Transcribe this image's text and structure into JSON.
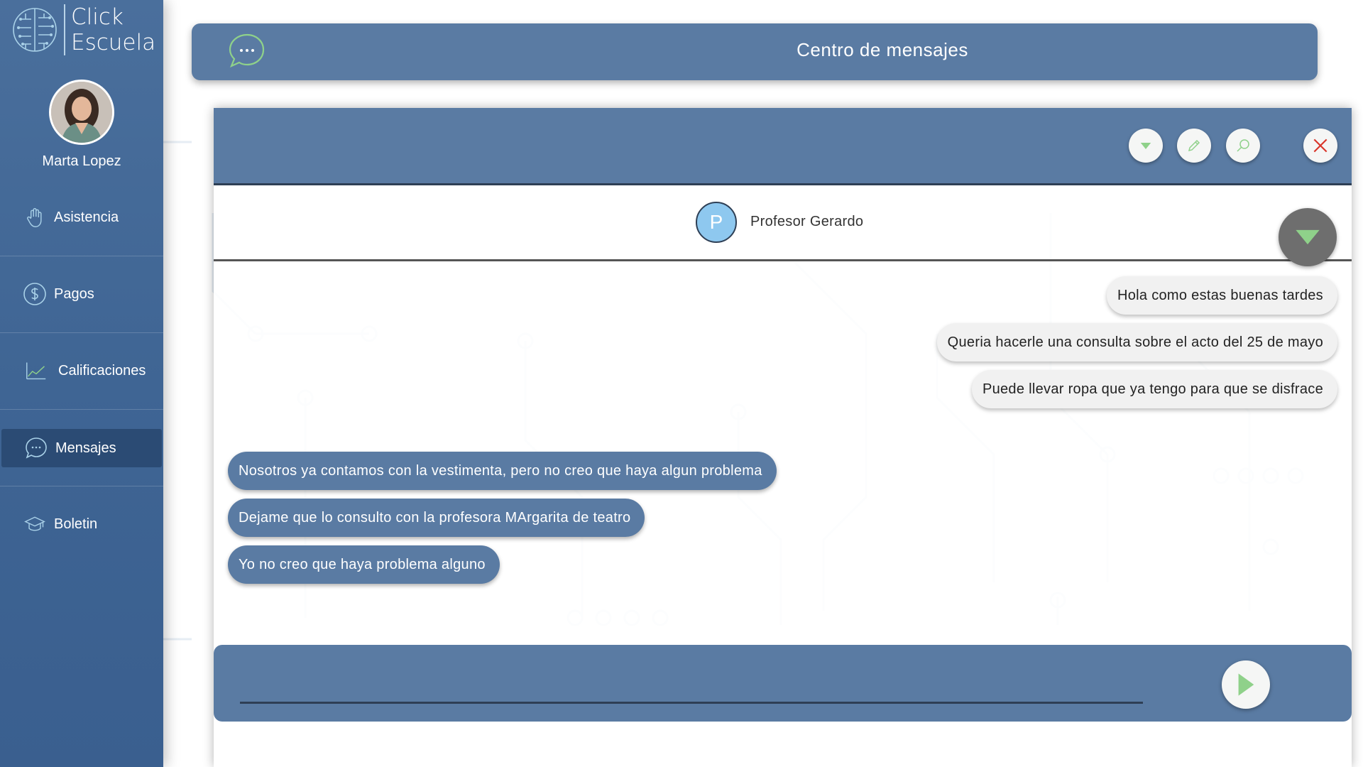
{
  "app": {
    "logo_line1": "Click",
    "logo_line2": "Escuela"
  },
  "user": {
    "name": "Marta Lopez"
  },
  "sidebar": {
    "items": [
      {
        "label": "Asistencia",
        "icon": "hand-icon"
      },
      {
        "label": "Pagos",
        "icon": "dollar-icon"
      },
      {
        "label": "Calificaciones",
        "icon": "chart-icon"
      },
      {
        "label": "Mensajes",
        "icon": "chat-icon",
        "active": true
      },
      {
        "label": "Boletin",
        "icon": "graduation-cap-icon"
      }
    ]
  },
  "header": {
    "title": "Centro de mensajes",
    "icon": "chat-icon"
  },
  "toolbar": {
    "buttons": [
      "dropdown-icon",
      "pencil-icon",
      "search-icon",
      "close-icon"
    ]
  },
  "contact": {
    "initial": "P",
    "name": "Profesor Gerardo"
  },
  "messages": {
    "sent": [
      "Hola como estas buenas tardes",
      "Queria hacerle una consulta sobre el acto del 25 de mayo",
      "Puede llevar ropa que ya tengo para que se disfrace"
    ],
    "received": [
      "Nosotros ya contamos con la vestimenta, pero no creo que haya algun problema",
      "Dejame que lo consulto con la profesora MArgarita de teatro",
      "Yo no creo que haya problema alguno"
    ]
  },
  "compose": {
    "value": "",
    "placeholder": ""
  },
  "colors": {
    "sidebar": "#3f6594",
    "accent": "#5a7ba3",
    "active_nav": "#2b4b74",
    "icon_green": "#8fd18a",
    "close_red": "#d9362b",
    "contact_avatar": "#8ec8ef"
  }
}
